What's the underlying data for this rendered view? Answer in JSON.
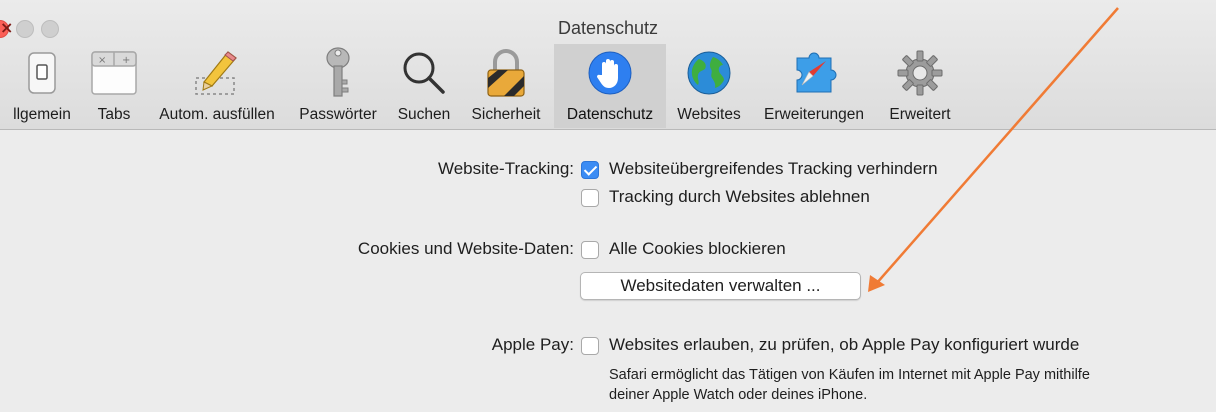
{
  "window": {
    "title": "Datenschutz"
  },
  "toolbar": {
    "tabs": [
      {
        "label": "llgemein",
        "icon": "switch-icon"
      },
      {
        "label": "Tabs",
        "icon": "tabs-icon"
      },
      {
        "label": "Autom. ausfüllen",
        "icon": "pencil-icon"
      },
      {
        "label": "Passwörter",
        "icon": "key-icon"
      },
      {
        "label": "Suchen",
        "icon": "magnifier-icon"
      },
      {
        "label": "Sicherheit",
        "icon": "padlock-icon"
      },
      {
        "label": "Datenschutz",
        "icon": "hand-icon",
        "active": true
      },
      {
        "label": "Websites",
        "icon": "globe-icon"
      },
      {
        "label": "Erweiterungen",
        "icon": "compass-icon"
      },
      {
        "label": "Erweitert",
        "icon": "gear-icon"
      }
    ]
  },
  "privacy": {
    "tracking": {
      "label": "Website-Tracking:",
      "options": [
        {
          "text": "Websiteübergreifendes Tracking verhindern",
          "checked": true
        },
        {
          "text": "Tracking durch Websites ablehnen",
          "checked": false
        }
      ]
    },
    "cookies": {
      "label": "Cookies und Website-Daten:",
      "option": {
        "text": "Alle Cookies blockieren",
        "checked": false
      },
      "button": "Websitedaten verwalten ..."
    },
    "apple_pay": {
      "label": "Apple Pay:",
      "option": {
        "text": "Websites erlauben, zu prüfen, ob Apple Pay konfiguriert wurde",
        "checked": false
      },
      "help_line1": "Safari ermöglicht das Tätigen von Käufen im Internet mit Apple Pay mithilfe",
      "help_line2": "deiner Apple Watch oder deines iPhone."
    }
  },
  "colors": {
    "accent": "#3b8cf4",
    "annotation_arrow": "#f07b35"
  }
}
